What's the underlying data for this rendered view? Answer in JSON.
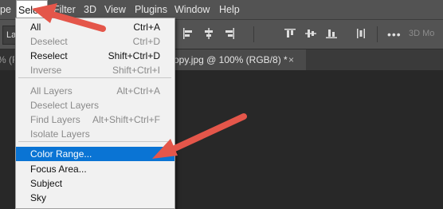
{
  "menubar": {
    "items": [
      "pe",
      "Select",
      "Filter",
      "3D",
      "View",
      "Plugins",
      "Window",
      "Help"
    ]
  },
  "optbar": {
    "layer_dropdown": "La",
    "more": "•••",
    "mode_3d": "3D Mo"
  },
  "tabs": {
    "left_fragment": "% (R",
    "active_title": "opy.jpg @ 100% (RGB/8) *",
    "active_close": "×"
  },
  "select_menu": {
    "groups": [
      [
        {
          "label": "All",
          "shortcut": "Ctrl+A",
          "enabled": true
        },
        {
          "label": "Deselect",
          "shortcut": "Ctrl+D",
          "enabled": false
        },
        {
          "label": "Reselect",
          "shortcut": "Shift+Ctrl+D",
          "enabled": true
        },
        {
          "label": "Inverse",
          "shortcut": "Shift+Ctrl+I",
          "enabled": false
        }
      ],
      [
        {
          "label": "All Layers",
          "shortcut": "Alt+Ctrl+A",
          "enabled": false
        },
        {
          "label": "Deselect Layers",
          "shortcut": "",
          "enabled": false
        },
        {
          "label": "Find Layers",
          "shortcut": "Alt+Shift+Ctrl+F",
          "enabled": false
        },
        {
          "label": "Isolate Layers",
          "shortcut": "",
          "enabled": false
        }
      ],
      [
        {
          "label": "Color Range...",
          "shortcut": "",
          "enabled": true,
          "highlighted": true
        },
        {
          "label": "Focus Area...",
          "shortcut": "",
          "enabled": true
        },
        {
          "label": "Subject",
          "shortcut": "",
          "enabled": true
        },
        {
          "label": "Sky",
          "shortcut": "",
          "enabled": true
        }
      ]
    ]
  },
  "colors": {
    "highlight": "#0a74d4",
    "annotation_arrow": "#e4564a",
    "menubar_bg": "#535353",
    "canvas_bg": "#282828"
  }
}
